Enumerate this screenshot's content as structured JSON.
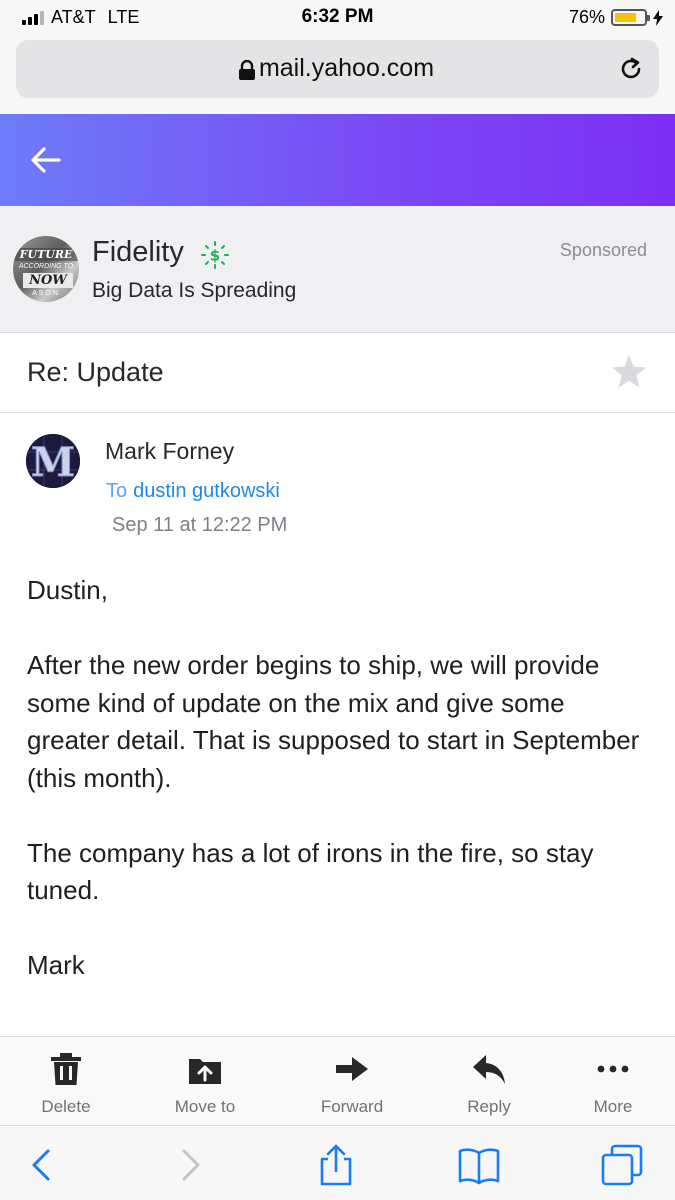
{
  "status_bar": {
    "carrier": "AT&T",
    "network": "LTE",
    "time": "6:32 PM",
    "battery": "76%",
    "battery_level": 0.76,
    "battery_color": "#f5c400"
  },
  "browser": {
    "url": "mail.yahoo.com",
    "icons": [
      "lock-icon",
      "reload-icon"
    ]
  },
  "header": {
    "gradient_start": "#6d7cf8",
    "gradient_end": "#7d2ff5",
    "back_icon": "back-arrow-icon"
  },
  "ad": {
    "logo_text": [
      "FUTURE",
      "ACCORDING TO",
      "NOW",
      "ASON"
    ],
    "advertiser": "Fidelity",
    "headline": "Big Data Is Spreading",
    "label": "Sponsored",
    "badge_icon": "sponsored-dollar-icon",
    "badge_color": "#1ab356"
  },
  "message": {
    "subject": "Re: Update",
    "sender": "Mark Forney",
    "avatar_letter": "M",
    "to_label": "To",
    "recipient": "dustin gutkowski",
    "date": "Sep 11 at 12:22 PM",
    "body": [
      "Dustin,",
      "After the new order begins to ship, we will provide some kind of update on the mix and give some greater detail. That is supposed to start in September (this month).",
      "The company has a lot of irons in the fire, so stay tuned.",
      "Mark"
    ]
  },
  "toolbar": {
    "items": [
      {
        "label": "Delete",
        "icon": "trash-icon"
      },
      {
        "label": "Move to",
        "icon": "move-to-folder-icon"
      },
      {
        "label": "Forward",
        "icon": "forward-arrow-icon"
      },
      {
        "label": "Reply",
        "icon": "reply-arrow-icon"
      },
      {
        "label": "More",
        "icon": "more-dots-icon"
      }
    ]
  },
  "safari_bar": {
    "icons": [
      "back-chevron-icon",
      "forward-chevron-icon",
      "share-icon",
      "bookmarks-icon",
      "tabs-icon"
    ],
    "accent": "#1a7cf5"
  }
}
